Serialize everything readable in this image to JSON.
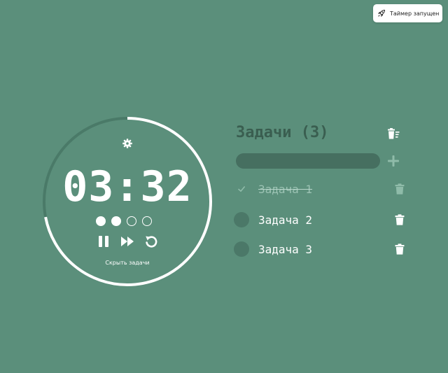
{
  "toast": {
    "text": "Таймер запущен",
    "icon": "rocket-icon"
  },
  "timer": {
    "time": "03:32",
    "progress": 0.72,
    "sessions": [
      true,
      true,
      false,
      false
    ],
    "hide_tasks_label": "Скрыть задачи",
    "ring_color": "#ffffff",
    "track_color": "#4a7a68"
  },
  "tasks": {
    "title": "Задачи (3)",
    "input_value": "",
    "items": [
      {
        "label": "Задача 1",
        "done": true
      },
      {
        "label": "Задача 2",
        "done": false
      },
      {
        "label": "Задача 3",
        "done": false
      }
    ]
  },
  "colors": {
    "background": "#5b8f7b",
    "title": "#3a5e50",
    "input": "#466f60",
    "muted": "#8fbba9"
  }
}
